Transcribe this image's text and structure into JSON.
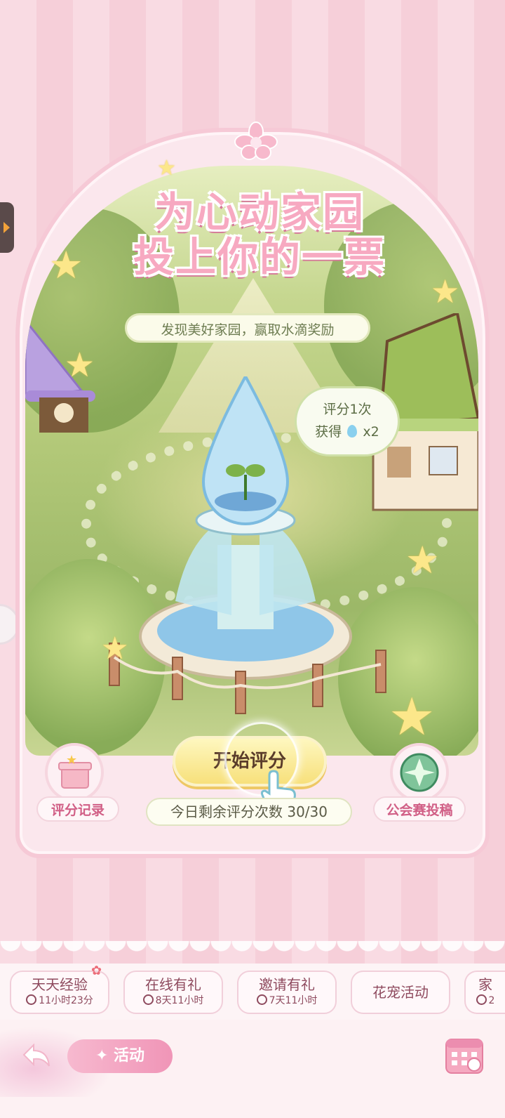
{
  "event": {
    "title_line1": "为心动家园",
    "title_line2": "投上你的一票",
    "subtitle": "发现美好家园，赢取水滴奖励",
    "bubble_line1": "评分1次",
    "bubble_line2_prefix": "获得",
    "bubble_line2_suffix": "x2",
    "start_button": "开始评分",
    "remaining_label": "今日剩余评分次数",
    "remaining_value": "30/30",
    "left_label": "评分记录",
    "right_label": "公会赛投稿"
  },
  "tabs": [
    {
      "label": "天天经验",
      "time": "11小时23分"
    },
    {
      "label": "在线有礼",
      "time": "8天11小时"
    },
    {
      "label": "邀请有礼",
      "time": "7天11小时"
    },
    {
      "label": "花宠活动",
      "time": ""
    },
    {
      "label": "家",
      "time": "2"
    }
  ],
  "bottom": {
    "activity_label": "活动"
  },
  "colors": {
    "pink_accent": "#f095b7",
    "title_pink": "#f7a9c1",
    "button_yellow": "#f7e07b",
    "label_pink": "#d15f86"
  }
}
